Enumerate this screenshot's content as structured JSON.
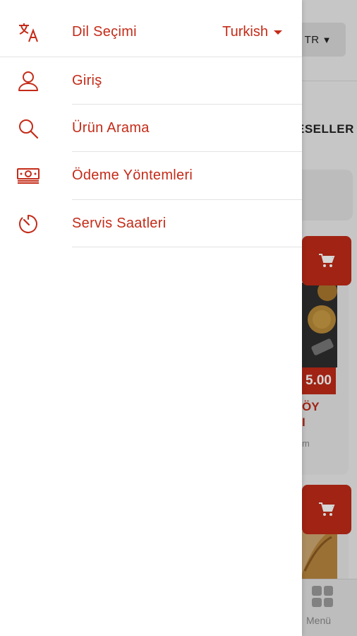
{
  "background_app": {
    "language_button": {
      "label": "TR"
    },
    "category_label": "ESELLER",
    "products": [
      {
        "price": "5.00",
        "name_partial": "ÖY",
        "name_partial_line2": "I",
        "unit_partial": "m"
      },
      {
        "price": "",
        "name_partial": "",
        "name_partial_line2": "",
        "unit_partial": ""
      }
    ],
    "bottom_nav": {
      "menu_label": "Menü"
    }
  },
  "drawer": {
    "items": [
      {
        "icon": "translate-icon",
        "label": "Dil Seçimi",
        "value": "Turkish"
      },
      {
        "icon": "person-icon",
        "label": "Giriş"
      },
      {
        "icon": "search-icon",
        "label": "Ürün Arama"
      },
      {
        "icon": "cash-icon",
        "label": "Ödeme Yöntemleri"
      },
      {
        "icon": "timer-icon",
        "label": "Servis Saatleri"
      }
    ]
  },
  "colors": {
    "accent": "#c42b18",
    "cart": "#bf2a17"
  }
}
